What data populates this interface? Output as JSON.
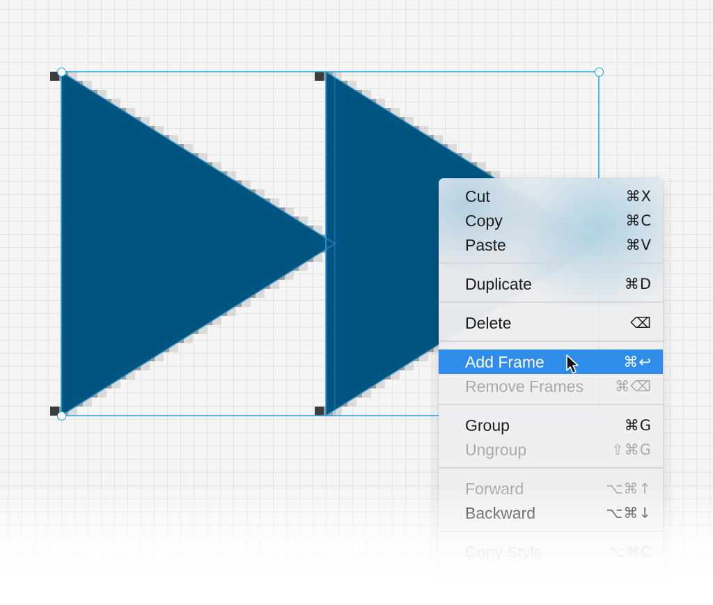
{
  "colors": {
    "shape_fill": "#005580",
    "selection": "#1ea0e8",
    "highlight": "#2f8ce8"
  },
  "context_menu": {
    "items": [
      {
        "label": "Cut",
        "shortcut": "⌘X",
        "enabled": true
      },
      {
        "label": "Copy",
        "shortcut": "⌘C",
        "enabled": true
      },
      {
        "label": "Paste",
        "shortcut": "⌘V",
        "enabled": true
      },
      {
        "label": "Duplicate",
        "shortcut": "⌘D",
        "enabled": true
      },
      {
        "label": "Delete",
        "shortcut": "⌫",
        "enabled": true
      },
      {
        "label": "Add Frame",
        "shortcut": "⌘↩",
        "enabled": true,
        "highlighted": true
      },
      {
        "label": "Remove Frames",
        "shortcut": "⌘⌫",
        "enabled": false
      },
      {
        "label": "Group",
        "shortcut": "⌘G",
        "enabled": true
      },
      {
        "label": "Ungroup",
        "shortcut": "⇧⌘G",
        "enabled": false
      },
      {
        "label": "Forward",
        "shortcut": "⌥⌘↑",
        "enabled": false
      },
      {
        "label": "Backward",
        "shortcut": "⌥⌘↓",
        "enabled": true
      },
      {
        "label": "Copy Style",
        "shortcut": "⌥⌘C",
        "enabled": false
      }
    ]
  }
}
